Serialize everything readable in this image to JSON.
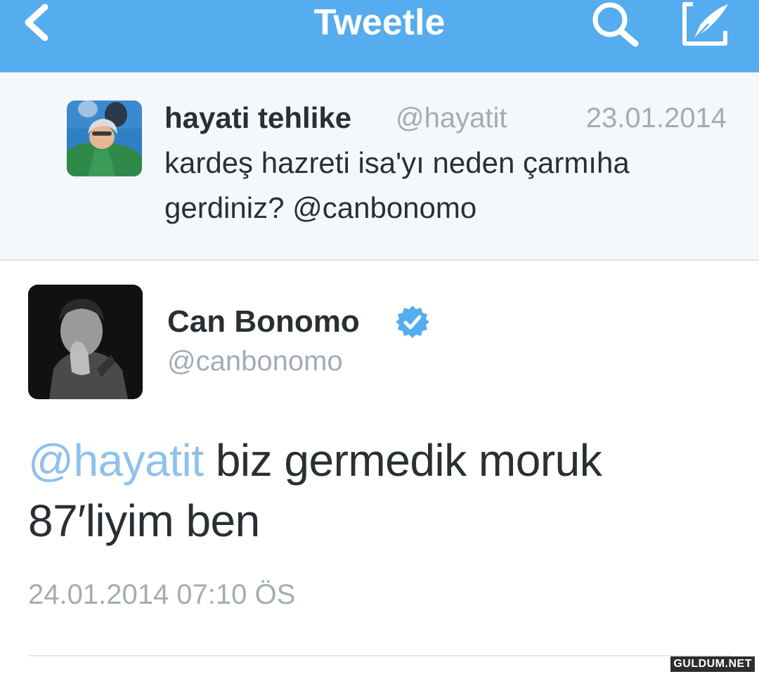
{
  "nav": {
    "title": "Tweetle",
    "back_icon": "chevron-left-icon",
    "search_icon": "search-icon",
    "compose_icon": "compose-icon"
  },
  "parent_tweet": {
    "name": "hayati tehlike",
    "handle": "@hayatit",
    "date": "23.01.2014",
    "text": "kardeş hazreti isa'yı neden çarmıha gerdiniz? @canbonomo"
  },
  "main_tweet": {
    "name": "Can Bonomo",
    "handle": "@canbonomo",
    "mention": "@hayatit",
    "text_line1": " biz germedik moruk",
    "text_line2": "87′liyim ben",
    "timestamp": "24.01.2014 07:10 ÖS"
  },
  "watermark": "GULDUM.NET",
  "colors": {
    "accent": "#55acee",
    "link": "#8fc1ea",
    "text": "#292f33",
    "muted": "#a3acb4",
    "panel": "#f5f8fa"
  }
}
